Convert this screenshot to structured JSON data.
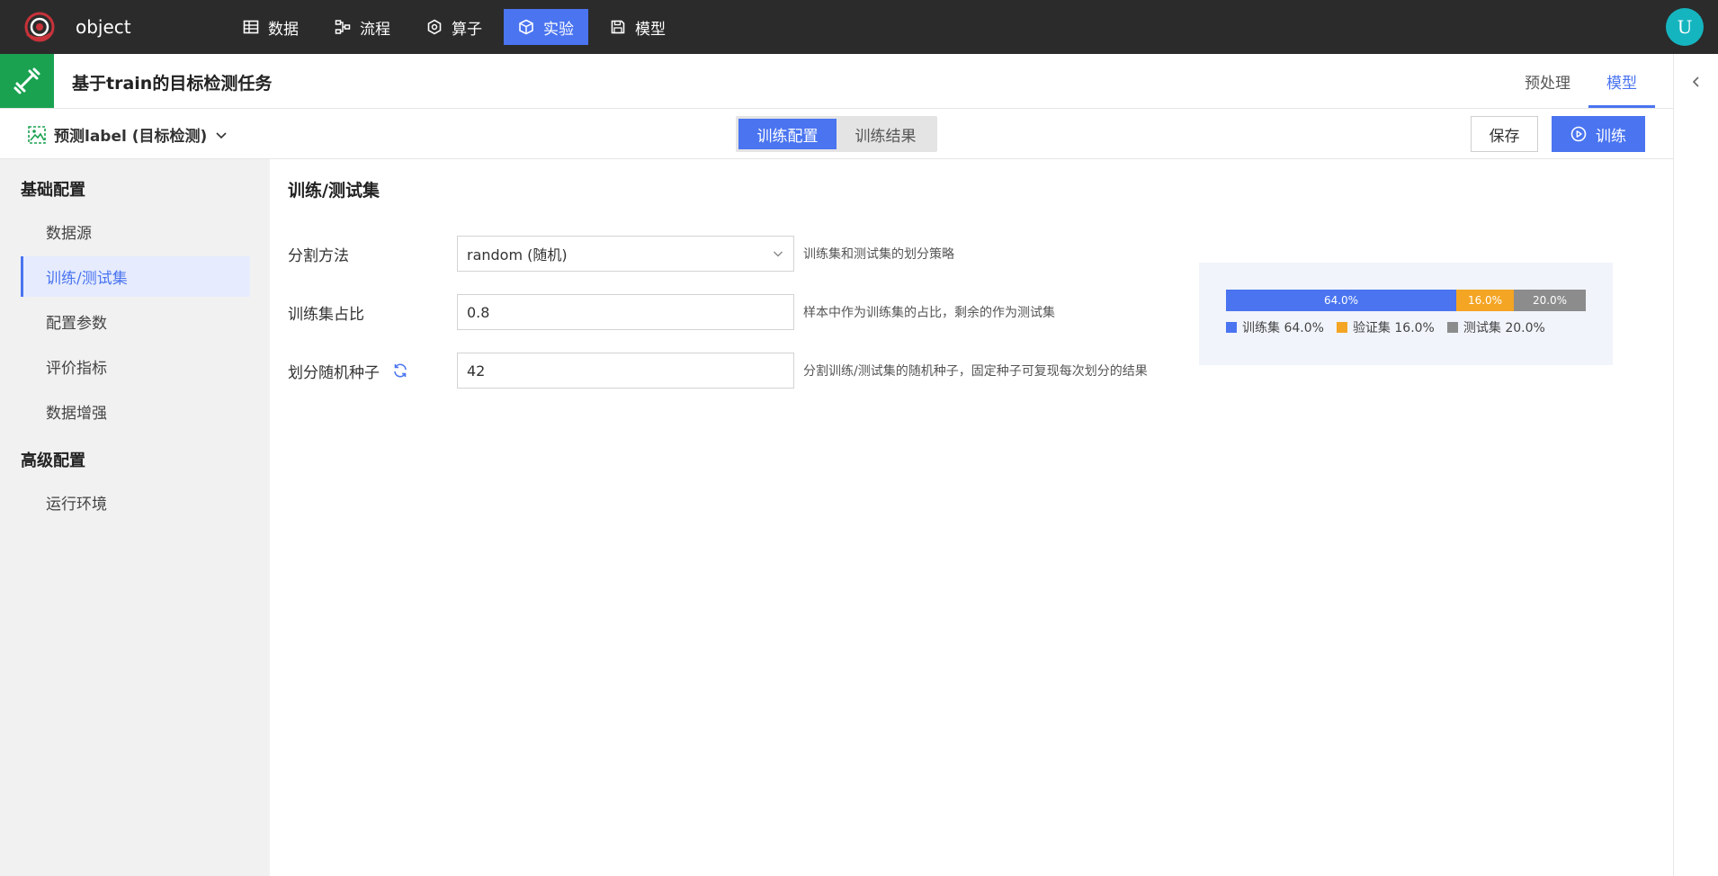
{
  "app": {
    "name": "object",
    "user_initial": "U"
  },
  "nav": {
    "items": [
      {
        "label": "数据",
        "icon": "table-icon"
      },
      {
        "label": "流程",
        "icon": "flow-icon"
      },
      {
        "label": "算子",
        "icon": "hexagon-icon"
      },
      {
        "label": "实验",
        "icon": "cube-icon",
        "active": true
      },
      {
        "label": "模型",
        "icon": "save-icon"
      }
    ]
  },
  "title_bar": {
    "title": "基于train的目标检测任务",
    "tabs": [
      {
        "label": "预处理"
      },
      {
        "label": "模型",
        "active": true
      }
    ]
  },
  "toolbar": {
    "task_select": "预测label (目标检测)",
    "segments": [
      {
        "label": "训练配置",
        "active": true
      },
      {
        "label": "训练结果"
      }
    ],
    "save_label": "保存",
    "train_label": "训练"
  },
  "sidebar": {
    "groups": [
      {
        "title": "基础配置",
        "items": [
          {
            "label": "数据源"
          },
          {
            "label": "训练/测试集",
            "active": true
          },
          {
            "label": "配置参数"
          },
          {
            "label": "评价指标"
          },
          {
            "label": "数据增强"
          }
        ]
      },
      {
        "title": "高级配置",
        "items": [
          {
            "label": "运行环境"
          }
        ]
      }
    ]
  },
  "main": {
    "section_title": "训练/测试集",
    "fields": [
      {
        "label": "分割方法",
        "value": "random (随机)",
        "hint": "训练集和测试集的划分策略"
      },
      {
        "label": "训练集占比",
        "value": "0.8",
        "hint": "样本中作为训练集的占比，剩余的作为测试集"
      },
      {
        "label": "划分随机种子",
        "value": "42",
        "hint": "分割训练/测试集的随机种子，固定种子可复现每次划分的结果"
      }
    ]
  },
  "split": {
    "segments": [
      {
        "name": "训练集",
        "value": 64.0,
        "label": "64.0%",
        "legend": "训练集 64.0%",
        "color": "#4a74f0"
      },
      {
        "name": "验证集",
        "value": 16.0,
        "label": "16.0%",
        "legend": "验证集 16.0%",
        "color": "#f4a523"
      },
      {
        "name": "测试集",
        "value": 20.0,
        "label": "20.0%",
        "legend": "测试集 20.0%",
        "color": "#8c8c8c"
      }
    ]
  },
  "colors": {
    "accent": "#4a74f0",
    "topbar": "#2b2b2b",
    "task_icon_bg": "#1aa251",
    "avatar": "#15b5c0"
  }
}
